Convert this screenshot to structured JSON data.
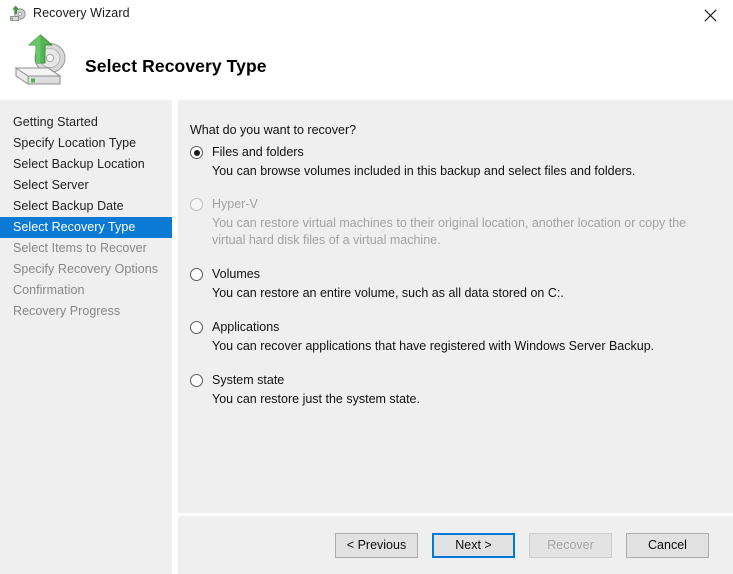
{
  "window": {
    "title": "Recovery Wizard",
    "title_icon": "recovery-wizard-icon",
    "close_icon": "close-icon"
  },
  "header": {
    "icon": "hard-drive-restore-icon",
    "title": "Select Recovery Type"
  },
  "sidebar": {
    "items": [
      {
        "label": "Getting Started",
        "state": "done"
      },
      {
        "label": "Specify Location Type",
        "state": "done"
      },
      {
        "label": "Select Backup Location",
        "state": "done"
      },
      {
        "label": "Select Server",
        "state": "done"
      },
      {
        "label": "Select Backup Date",
        "state": "done"
      },
      {
        "label": "Select Recovery Type",
        "state": "active"
      },
      {
        "label": "Select Items to Recover",
        "state": "upcoming"
      },
      {
        "label": "Specify Recovery Options",
        "state": "upcoming"
      },
      {
        "label": "Confirmation",
        "state": "upcoming"
      },
      {
        "label": "Recovery Progress",
        "state": "upcoming"
      }
    ],
    "active_color": "#0b7ad5"
  },
  "main": {
    "question": "What do you want to recover?",
    "options": [
      {
        "label": "Files and folders",
        "description": "You can browse volumes included in this backup and select files and folders.",
        "selected": true,
        "enabled": true
      },
      {
        "label": "Hyper-V",
        "description": "You can restore virtual machines to their original location, another location or copy the virtual hard disk files of a virtual machine.",
        "selected": false,
        "enabled": false
      },
      {
        "label": "Volumes",
        "description": "You can restore an entire volume, such as all data stored on C:.",
        "selected": false,
        "enabled": true
      },
      {
        "label": "Applications",
        "description": "You can recover applications that have registered with Windows Server Backup.",
        "selected": false,
        "enabled": true
      },
      {
        "label": "System state",
        "description": "You can restore just the system state.",
        "selected": false,
        "enabled": true
      }
    ]
  },
  "footer": {
    "previous_label": "< Previous",
    "next_label": "Next >",
    "recover_label": "Recover",
    "cancel_label": "Cancel"
  }
}
